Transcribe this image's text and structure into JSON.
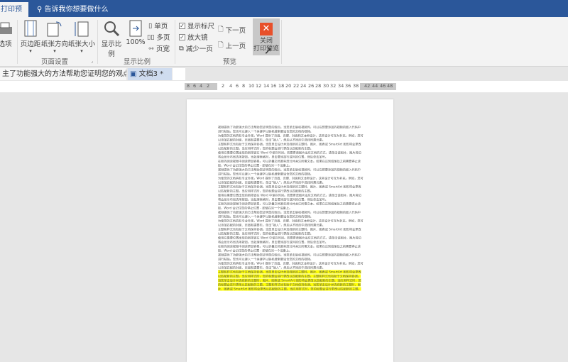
{
  "titlebar": {
    "active_tab": "打印预览",
    "tell_me": "告诉我你想要做什么"
  },
  "ribbon": {
    "options": "选项",
    "margins": "页边距",
    "orientation": "纸张方向",
    "size": "纸张大小",
    "page_setup": "页面设置",
    "zoom": "显示比例",
    "zoom100": "100%",
    "one_page": "单页",
    "multi_page": "多页",
    "page_width": "页宽",
    "zoom_group": "显示比例",
    "show_ruler": "显示标尺",
    "magnifier": "放大镜",
    "shrink": "减少一页",
    "next_page": "下一页",
    "prev_page": "上一页",
    "preview_group": "预览",
    "close_line1": "关闭",
    "close_line2": "打印预览"
  },
  "doctabs": [
    {
      "label": "主了功能强大的方法帮助您证明您的观点.docx"
    },
    {
      "label": "文档3 *"
    }
  ],
  "ruler": [
    "8",
    "6",
    "4",
    "2",
    "2",
    "4",
    "6",
    "8",
    "10",
    "12",
    "14",
    "16",
    "18",
    "20",
    "22",
    "24",
    "26",
    "28",
    "30",
    "32",
    "34",
    "36",
    "38",
    "42",
    "44",
    "46",
    "48"
  ],
  "document": {
    "paragraphs": [
      "视频提供了功能强大的方法帮助您证明您的观点。当您单击联机视频时，可以在想要添加的视频的嵌入代码中进行粘贴。您也可以键入一个关键字以联机搜索最适合您的文档的视频。",
      "为使您的文档具有专业外观，Word 提供了页眉、页脚、封面和文本框设计，这些设计可互为补充。例如，您可以添加匹配的封面、页眉和提要栏。单击“插入”，然后从不同库中选择所需元素。",
      "主题和样式也有助于文档保持协调。当您单击设计并选择新的主题时，图片、图表或 SmartArt 图形将会更改以匹配新的主题。当应用样式时，您的标题会进行更改以匹配新的主题。",
      "使用在需要位置出现的新按钮在 Word 中保存时间。若要更改图片适应文档的方式，请单击该图片，图片旁边将会显示布局选项按钮。当处理表格时，单击要添加行或列的位置，然后单击加号。",
      "在新的阅读视图中阅读更加容易。可以折叠文档某些部分并关注所需文本。如果在达到结尾处之前需要停止读取，Word 会记住您的停止位置 - 即使在另一个设备上。"
    ],
    "highlighted": "主题和样式也有助于文档保持协调。当您单击设计并选择新的主题时，图片、图表或 SmartArt 图形将会更改以匹配新的主题。当应用样式时，您的标题会进行更改以匹配新的主题。主题和样式也有助于文档保持协调。当您单击设计并选择新的主题时，图片、图表或 SmartArt 图形将会更改以匹配新的主题。当应用样式时，您的标题会进行更改以匹配新的主题。主题和样式也有助于文档保持协调。当您单击设计并选择新的主题时，图片、图表或 SmartArt 图形将会更改以匹配新的主题。当应用样式时，您的标题会进行更改以匹配新的主题。"
  }
}
